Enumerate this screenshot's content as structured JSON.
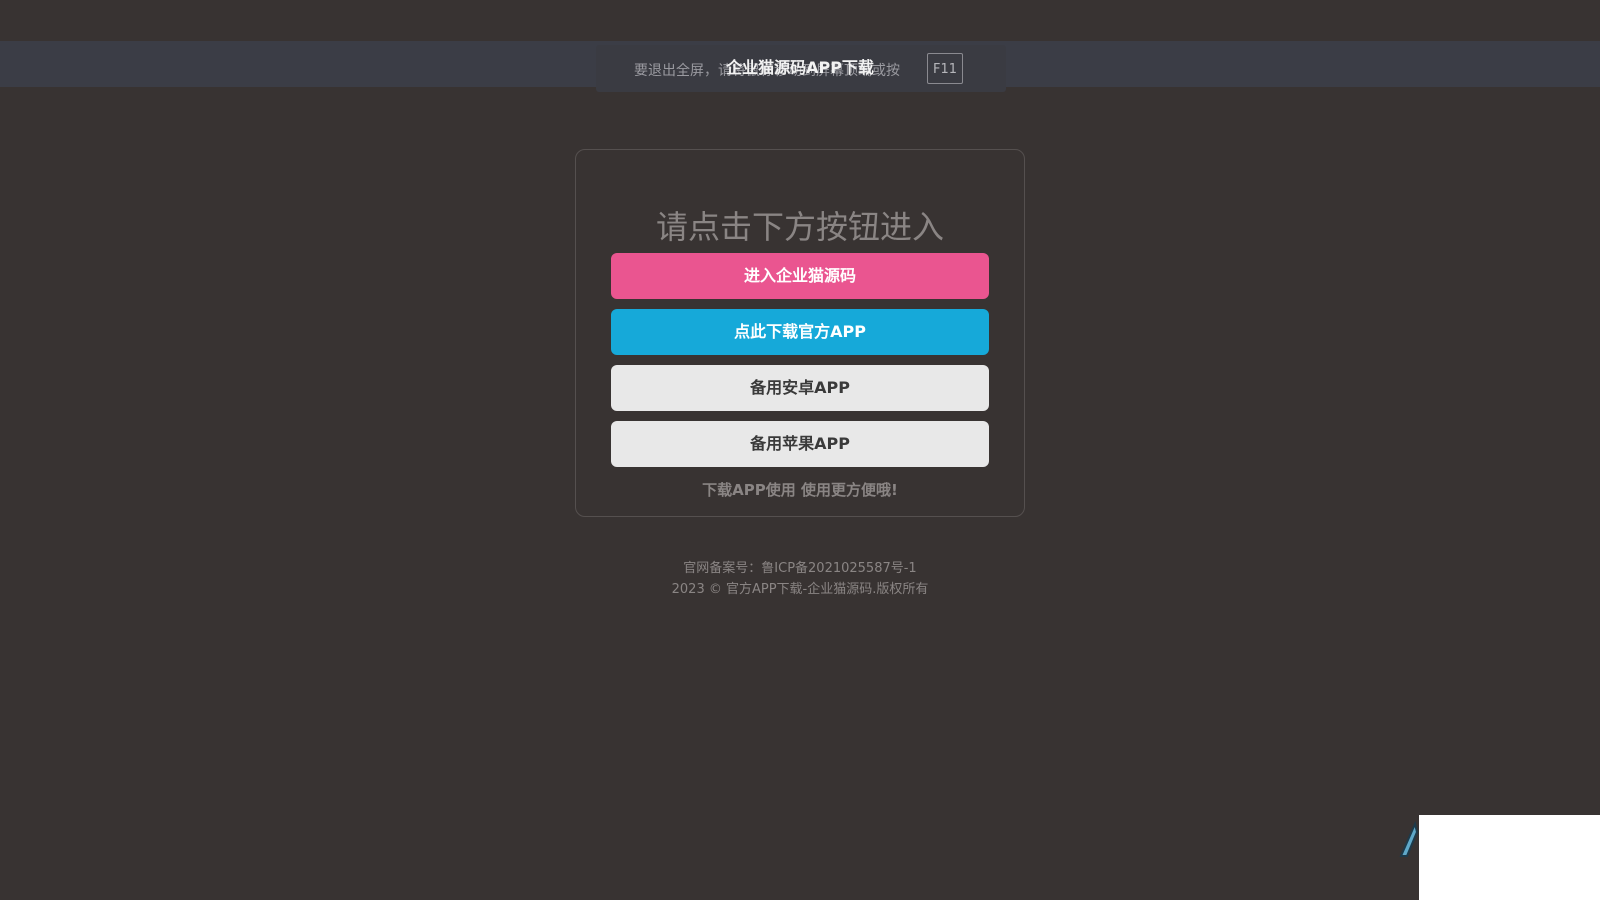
{
  "fullscreen_notice": {
    "text": "要退出全屏，请将鼠标移动到屏幕顶端或按",
    "key": "F11"
  },
  "header": {
    "title": "企业猫源码APP下载"
  },
  "card": {
    "heading": "请点击下方按钮进入",
    "buttons": {
      "enter": "进入企业猫源码",
      "download_official": "点此下载官方APP",
      "backup_android": "备用安卓APP",
      "backup_ios": "备用苹果APP"
    },
    "tip": "下载APP使用 使用更方便哦!"
  },
  "footer": {
    "icp": "官网备案号：鲁ICP备2021025587号-1",
    "copyright": "2023 © 官方APP下载-企业猫源码.版权所有"
  },
  "colors": {
    "background": "#383332",
    "enter_button": "#ea5590",
    "download_button": "#16a9d9",
    "backup_button": "#e8e8e8"
  }
}
